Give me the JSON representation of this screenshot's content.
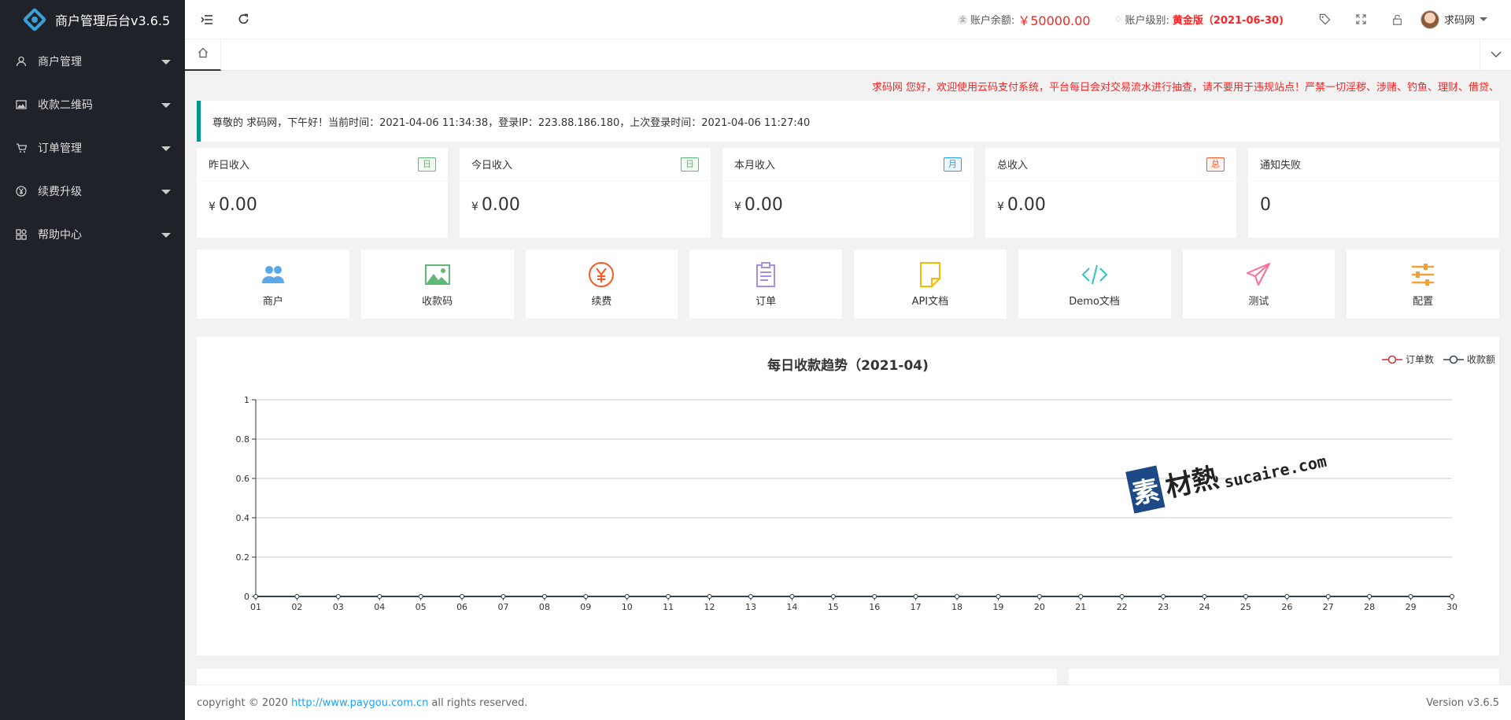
{
  "app": {
    "title": "商户管理后台v3.6.5"
  },
  "sidebar": {
    "items": [
      {
        "label": "商户管理",
        "icon": "user-icon"
      },
      {
        "label": "收款二维码",
        "icon": "image-icon"
      },
      {
        "label": "订单管理",
        "icon": "cart-icon"
      },
      {
        "label": "续费升级",
        "icon": "yen-circle-icon"
      },
      {
        "label": "帮助中心",
        "icon": "apps-icon"
      }
    ]
  },
  "header": {
    "balance_label": "账户余额:",
    "balance_value": "￥50000.00",
    "level_label": "账户级别:",
    "level_value": "黄金版（2021-06-30)",
    "username": "求码网"
  },
  "notice": "求码网 您好，欢迎使用云码支付系统，平台每日会对交易流水进行抽查，请不要用于违规站点！严禁一切淫秽、涉赌、钓鱼、理财、借贷、",
  "welcome": "尊敬的 求码网，下午好！当前时间：2021-04-06 11:34:38，登录IP：223.88.186.180，上次登录时间：2021-04-06 11:27:40",
  "stats": [
    {
      "label": "昨日收入",
      "badge": "日",
      "badge_type": "green",
      "currency": "¥",
      "value": "0.00"
    },
    {
      "label": "今日收入",
      "badge": "日",
      "badge_type": "green",
      "currency": "¥",
      "value": "0.00"
    },
    {
      "label": "本月收入",
      "badge": "月",
      "badge_type": "blue",
      "currency": "¥",
      "value": "0.00"
    },
    {
      "label": "总收入",
      "badge": "总",
      "badge_type": "red",
      "currency": "¥",
      "value": "0.00"
    },
    {
      "label": "通知失败",
      "badge": "",
      "badge_type": "",
      "currency": "",
      "value": "0"
    }
  ],
  "shortcuts": [
    {
      "label": "商户",
      "icon": "users-icon",
      "color": "#5aa9e6"
    },
    {
      "label": "收款码",
      "icon": "picture-icon",
      "color": "#5FB878"
    },
    {
      "label": "续费",
      "icon": "yen-icon",
      "color": "#FF5722"
    },
    {
      "label": "订单",
      "icon": "clipboard-icon",
      "color": "#a98ee6"
    },
    {
      "label": "API文档",
      "icon": "document-icon",
      "color": "#FFB800"
    },
    {
      "label": "Demo文档",
      "icon": "code-icon",
      "color": "#2ec4c4"
    },
    {
      "label": "测试",
      "icon": "send-icon",
      "color": "#ff6b9a"
    },
    {
      "label": "配置",
      "icon": "sliders-icon",
      "color": "#f0a13a"
    }
  ],
  "chart_data": {
    "type": "line",
    "title": "每日收款趋势（2021-04)",
    "categories": [
      "01",
      "02",
      "03",
      "04",
      "05",
      "06",
      "07",
      "08",
      "09",
      "10",
      "11",
      "12",
      "13",
      "14",
      "15",
      "16",
      "17",
      "18",
      "19",
      "20",
      "21",
      "22",
      "23",
      "24",
      "25",
      "26",
      "27",
      "28",
      "29",
      "30"
    ],
    "series": [
      {
        "name": "订单数",
        "color": "#c23531",
        "values": [
          0,
          0,
          0,
          0,
          0,
          0,
          0,
          0,
          0,
          0,
          0,
          0,
          0,
          0,
          0,
          0,
          0,
          0,
          0,
          0,
          0,
          0,
          0,
          0,
          0,
          0,
          0,
          0,
          0,
          0
        ]
      },
      {
        "name": "收款额",
        "color": "#2f4554",
        "values": [
          0,
          0,
          0,
          0,
          0,
          0,
          0,
          0,
          0,
          0,
          0,
          0,
          0,
          0,
          0,
          0,
          0,
          0,
          0,
          0,
          0,
          0,
          0,
          0,
          0,
          0,
          0,
          0,
          0,
          0
        ]
      }
    ],
    "yticks": [
      "0",
      "0.2",
      "0.4",
      "0.6",
      "0.8",
      "1"
    ],
    "ylim": [
      0,
      1
    ],
    "legend_position": "top-right"
  },
  "watermark": {
    "glyph": "素",
    "text": "材熱",
    "sub": "sucaire.com"
  },
  "footer": {
    "copyright": "copyright © 2020",
    "link": "http://www.paygou.com.cn",
    "rights": "all rights reserved.",
    "version": "Version v3.6.5"
  }
}
